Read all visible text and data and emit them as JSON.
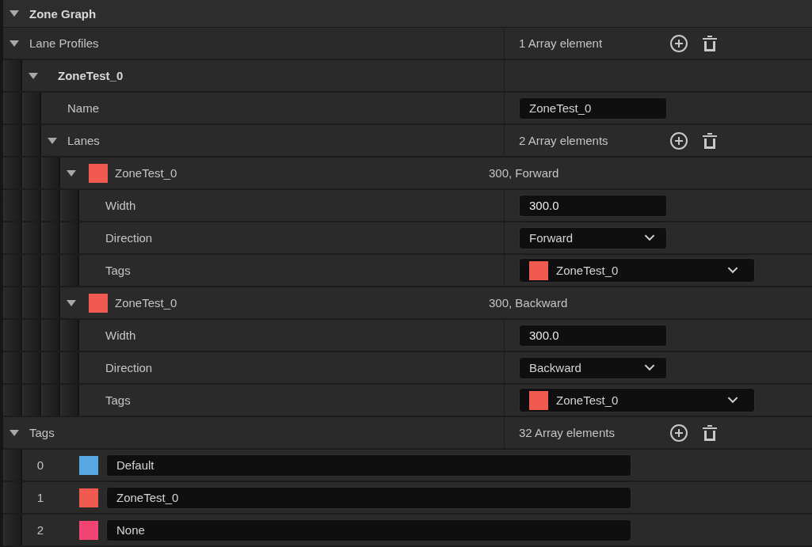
{
  "category": {
    "label": "Zone Graph",
    "expanded": true
  },
  "properties": [
    {
      "kind": "array",
      "label": "Lane Profiles",
      "expanded": true,
      "summary": "1 Array element",
      "children": [
        {
          "kind": "struct",
          "label": "ZoneTest_0",
          "expanded": true,
          "children": [
            {
              "kind": "text",
              "label": "Name",
              "value": "ZoneTest_0"
            },
            {
              "kind": "array",
              "label": "Lanes",
              "expanded": true,
              "summary": "2 Array elements",
              "children": [
                {
                  "kind": "lane",
                  "label": "ZoneTest_0",
                  "color": "#f05a50",
                  "expanded": true,
                  "summary": "300, Forward",
                  "children": [
                    {
                      "kind": "number",
                      "label": "Width",
                      "value": "300.0"
                    },
                    {
                      "kind": "combo",
                      "label": "Direction",
                      "value": "Forward"
                    },
                    {
                      "kind": "tag",
                      "label": "Tags",
                      "value": "ZoneTest_0",
                      "color": "#f05a50"
                    }
                  ]
                },
                {
                  "kind": "lane",
                  "label": "ZoneTest_0",
                  "color": "#f05a50",
                  "expanded": true,
                  "summary": "300, Backward",
                  "children": [
                    {
                      "kind": "number",
                      "label": "Width",
                      "value": "300.0"
                    },
                    {
                      "kind": "combo",
                      "label": "Direction",
                      "value": "Backward"
                    },
                    {
                      "kind": "tag",
                      "label": "Tags",
                      "value": "ZoneTest_0",
                      "color": "#f05a50"
                    }
                  ]
                }
              ]
            }
          ]
        }
      ]
    },
    {
      "kind": "array",
      "label": "Tags",
      "expanded": true,
      "summary": "32 Array elements",
      "children": [
        {
          "kind": "entry",
          "index": "0",
          "color": "#56a8e0",
          "value": "Default"
        },
        {
          "kind": "entry",
          "index": "1",
          "color": "#f05a50",
          "value": "ZoneTest_0"
        },
        {
          "kind": "entry",
          "index": "2",
          "color": "#f04474",
          "value": "None"
        }
      ]
    }
  ]
}
